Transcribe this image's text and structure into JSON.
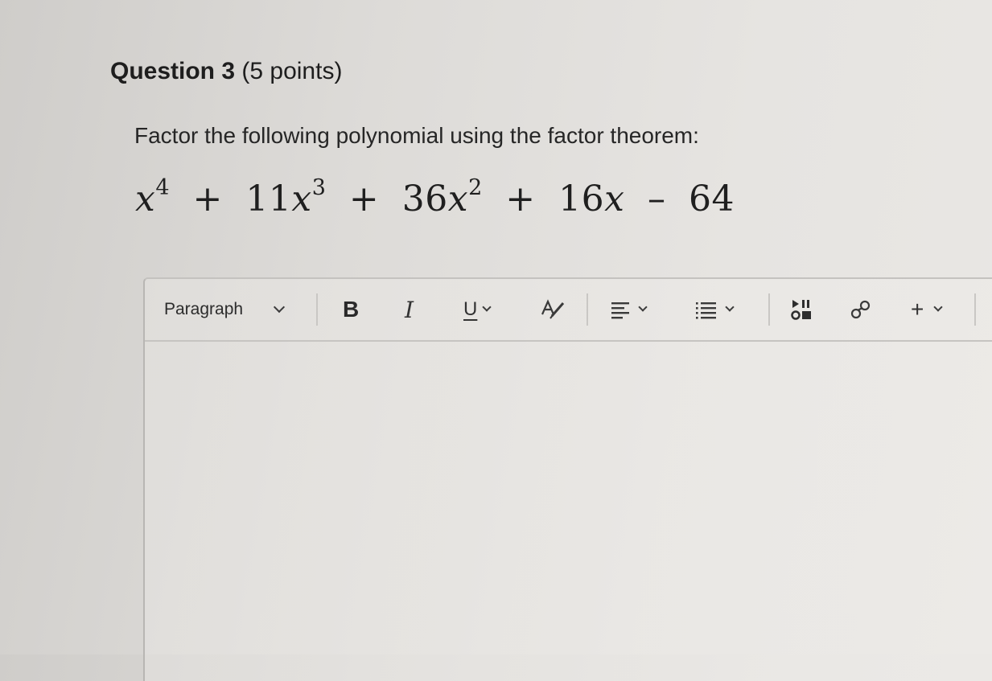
{
  "question": {
    "number_label": "Question 3",
    "points_label": "(5 points)",
    "prompt": "Factor the following polynomial using the factor theorem:",
    "expression": {
      "var": "x",
      "t1_exp": "4",
      "plus": "+",
      "t2_coef": "11",
      "t2_exp": "3",
      "t3_coef": "36",
      "t3_exp": "2",
      "t4_coef": "16",
      "minus": "–",
      "constant": "64"
    }
  },
  "editor": {
    "toolbar": {
      "block_format": "Paragraph",
      "bold_label": "B",
      "italic_label": "I",
      "underline_label": "U",
      "insert_label": "+"
    },
    "content": ""
  }
}
